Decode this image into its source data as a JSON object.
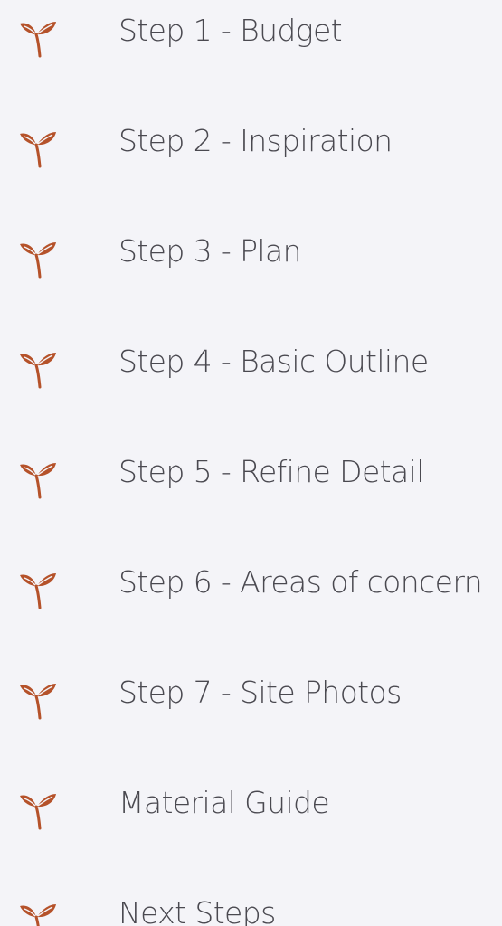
{
  "accent_color": "#b5522a",
  "nav": {
    "icon": "sprout-icon",
    "items": [
      {
        "label": "Step 1 - Budget"
      },
      {
        "label": "Step 2 - Inspiration"
      },
      {
        "label": "Step 3 - Plan"
      },
      {
        "label": "Step 4 - Basic Outline"
      },
      {
        "label": "Step 5 - Refine Detail"
      },
      {
        "label": "Step 6 - Areas of concern"
      },
      {
        "label": "Step 7 - Site Photos"
      },
      {
        "label": "Material Guide"
      },
      {
        "label": "Next Steps"
      }
    ]
  }
}
